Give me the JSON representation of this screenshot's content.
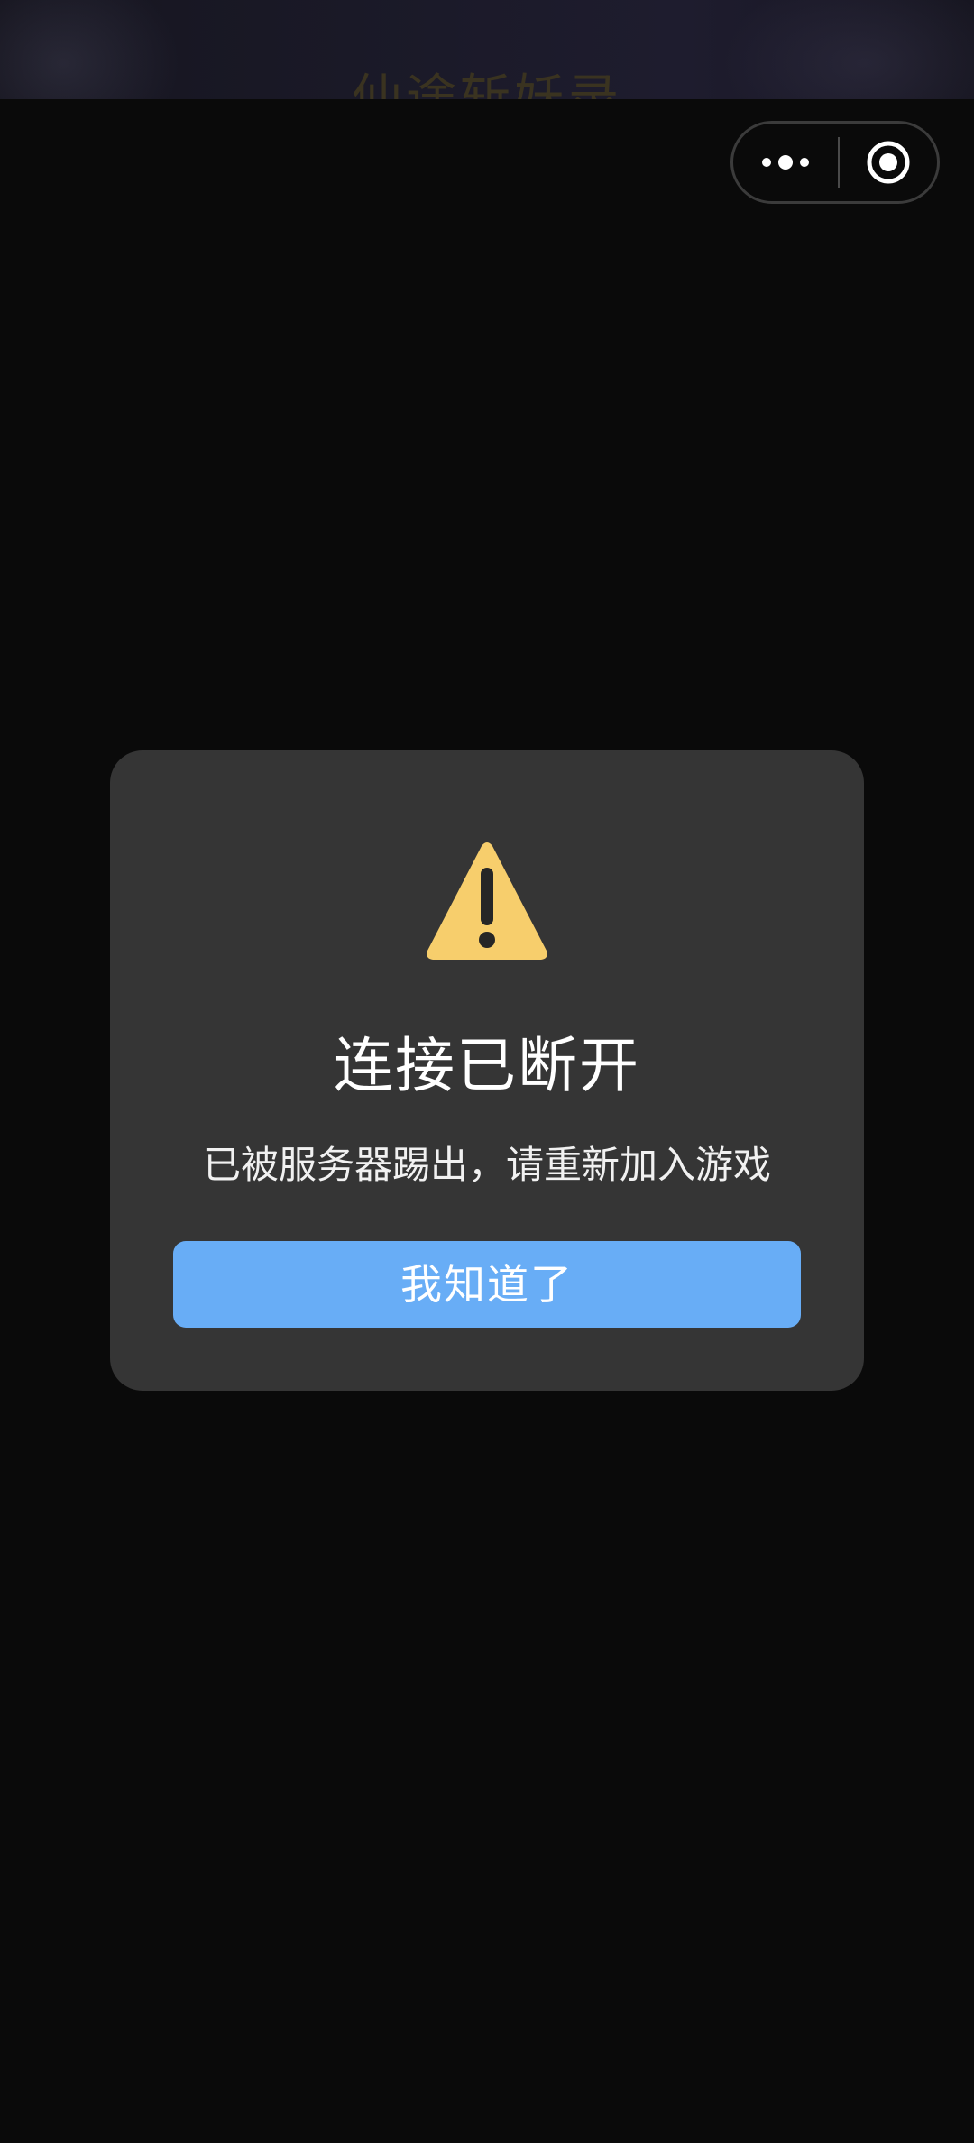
{
  "background": {
    "game_title": "仙途斩妖录"
  },
  "capsule_menu": {
    "more_icon": "more-dots-icon",
    "close_icon": "target-close-icon"
  },
  "dialog": {
    "icon": "warning-triangle-icon",
    "title": "连接已断开",
    "message": "已被服务器踢出，请重新加入游戏",
    "confirm_label": "我知道了"
  },
  "colors": {
    "warning": "#f7ce6c",
    "button": "#68adf6",
    "dialog_bg": "#353535",
    "page_bg": "#0a0a0a"
  }
}
